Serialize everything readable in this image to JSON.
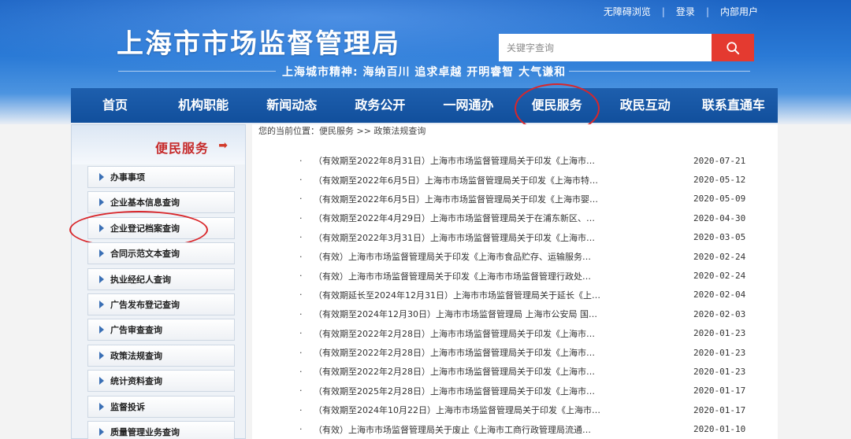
{
  "header": {
    "top_links": [
      "无障碍浏览",
      "登录",
      "内部用户"
    ],
    "site_title": "上海市市场监督管理局",
    "slogan": "上海城市精神: 海纳百川 追求卓越 开明睿智 大气谦和",
    "search_placeholder": "关键字查询",
    "search_icon": "search-icon"
  },
  "nav": {
    "items": [
      "首页",
      "机构职能",
      "新闻动态",
      "政务公开",
      "一网通办",
      "便民服务",
      "政民互动",
      "联系直通车"
    ],
    "active": "便民服务"
  },
  "sidebar": {
    "title": "便民服务",
    "arrow": "➡",
    "items": [
      "办事事项",
      "企业基本信息查询",
      "企业登记档案查询",
      "合同示范文本查询",
      "执业经纪人查询",
      "广告发布登记查询",
      "广告审查查询",
      "政策法规查询",
      "统计资料查询",
      "监督投诉",
      "质量管理业务查询"
    ]
  },
  "breadcrumb": {
    "prefix": "您的当前位置：",
    "path": "便民服务 >> 政策法规查询"
  },
  "list": [
    {
      "title": "（有效期至2022年8月31日）上海市市场监督管理局关于印发《上海市…",
      "date": "2020-07-21"
    },
    {
      "title": "（有效期至2022年6月5日）上海市市场监督管理局关于印发《上海市特…",
      "date": "2020-05-12"
    },
    {
      "title": "（有效期至2022年6月5日）上海市市场监督管理局关于印发《上海市婴…",
      "date": "2020-05-09"
    },
    {
      "title": "（有效期至2022年4月29日）上海市市场监督管理局关于在浦东新区、…",
      "date": "2020-04-30"
    },
    {
      "title": "（有效期至2022年3月31日）上海市市场监督管理局关于印发《上海市…",
      "date": "2020-03-05"
    },
    {
      "title": "（有效）上海市市场监督管理局关于印发《上海市食品贮存、运输服务…",
      "date": "2020-02-24"
    },
    {
      "title": "（有效）上海市市场监督管理局关于印发《上海市市场监督管理行政处…",
      "date": "2020-02-24"
    },
    {
      "title": "（有效期延长至2024年12月31日）上海市市场监督管理局关于延长《上…",
      "date": "2020-02-04"
    },
    {
      "title": "（有效期至2024年12月30日）上海市市场监督管理局 上海市公安局 国…",
      "date": "2020-02-03"
    },
    {
      "title": "（有效期至2022年2月28日）上海市市场监督管理局关于印发《上海市…",
      "date": "2020-01-23"
    },
    {
      "title": "（有效期至2022年2月28日）上海市市场监督管理局关于印发《上海市…",
      "date": "2020-01-23"
    },
    {
      "title": "（有效期至2022年2月28日）上海市市场监督管理局关于印发《上海市…",
      "date": "2020-01-23"
    },
    {
      "title": "（有效期至2025年2月28日）上海市市场监督管理局关于印发《上海市…",
      "date": "2020-01-17"
    },
    {
      "title": "（有效期至2024年10月22日）上海市市场监督管理局关于印发《上海市…",
      "date": "2020-01-17"
    },
    {
      "title": "（有效）上海市市场监督管理局关于废止《上海市工商行政管理局流通…",
      "date": "2020-01-10"
    }
  ]
}
